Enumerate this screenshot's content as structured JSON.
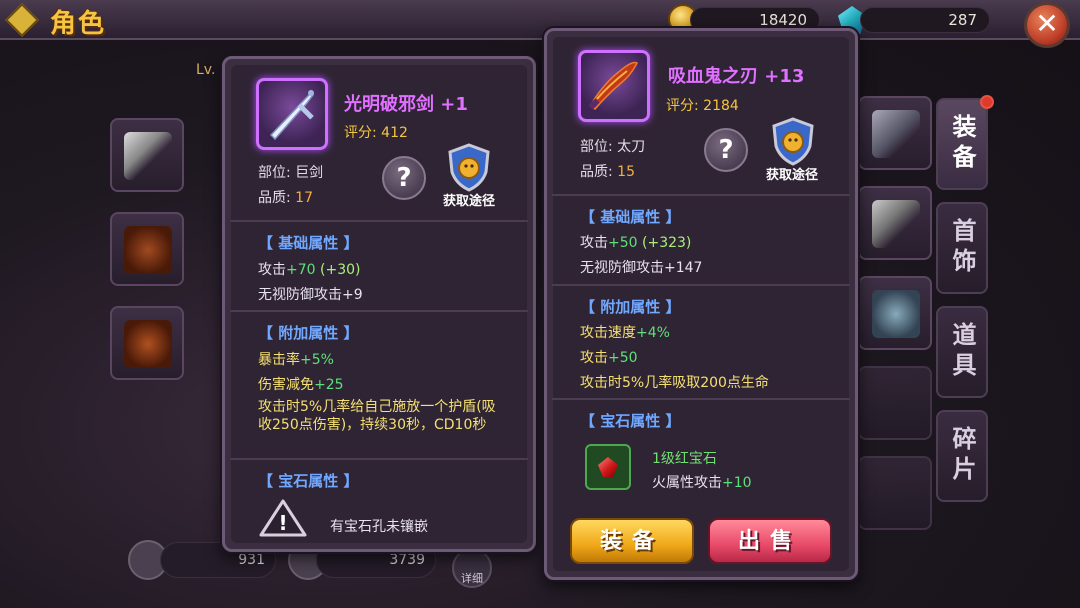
{
  "header": {
    "title": "角色",
    "gold": "18420",
    "gems": "287",
    "close_label": "✕"
  },
  "background": {
    "level_prefix": "Lv.",
    "side_tabs": [
      "装备",
      "首饰",
      "道具",
      "碎片"
    ],
    "stats": [
      "931",
      "3739"
    ],
    "detail_label": "详细"
  },
  "left_item": {
    "name": "光明破邪剑",
    "plus": "+1",
    "rating_label": "评分:",
    "rating": "412",
    "slot_label": "部位:",
    "slot": "巨剑",
    "quality_label": "品质:",
    "quality": "17",
    "help_label": "?",
    "source_label": "获取途径",
    "basic_title": "【 基础属性 】",
    "basic": [
      {
        "label": "攻击",
        "value": "+70",
        "extra": "(+30)"
      },
      {
        "label": "无视防御攻击+9"
      }
    ],
    "extra_title": "【 附加属性 】",
    "extra_attrs": [
      {
        "label": "暴击率",
        "value": "+5%"
      },
      {
        "label": "伤害减免",
        "value": "+25"
      },
      {
        "label": "攻击时5%几率给自己施放一个护盾(吸收250点伤害)，持续30秒，CD10秒"
      }
    ],
    "gem_title": "【 宝石属性 】",
    "gem_empty": "有宝石孔未镶嵌",
    "warn_symbol": "!"
  },
  "right_item": {
    "name": "吸血鬼之刃",
    "plus": "+13",
    "rating_label": "评分:",
    "rating": "2184",
    "slot_label": "部位:",
    "slot": "太刀",
    "quality_label": "品质:",
    "quality": "15",
    "help_label": "?",
    "source_label": "获取途径",
    "basic_title": "【 基础属性 】",
    "basic": [
      {
        "label": "攻击",
        "value": "+50",
        "extra": "(+323)"
      },
      {
        "label": "无视防御攻击+147"
      }
    ],
    "extra_title": "【 附加属性 】",
    "extra_attrs": [
      {
        "label": "攻击速度",
        "value": "+4%"
      },
      {
        "label": "攻击",
        "value": "+50"
      },
      {
        "label": "攻击时5%几率吸取200点生命"
      }
    ],
    "gem_title": "【 宝石属性 】",
    "gem": {
      "name": "1级红宝石",
      "attr_label": "火属性攻击",
      "attr_value": "+10"
    },
    "equip_label": "装备",
    "sell_label": "出售"
  },
  "colors": {
    "item_name": "#e070ff",
    "section_title": "#70a8ff",
    "positive_value": "#5ee07a",
    "rating": "#f4c640"
  }
}
